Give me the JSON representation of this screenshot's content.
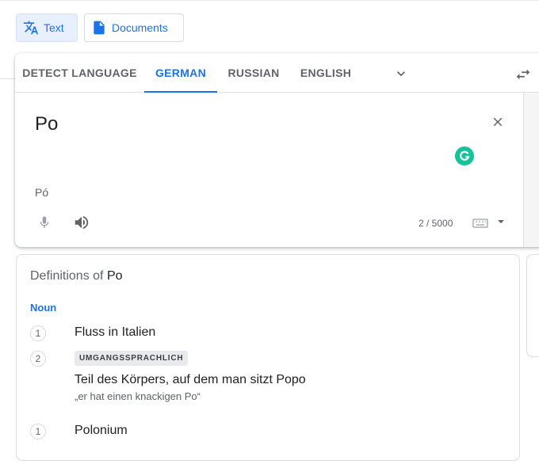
{
  "mode_tabs": [
    {
      "label": "Text",
      "icon": "translate-icon",
      "active": true
    },
    {
      "label": "Documents",
      "icon": "document-icon",
      "active": false
    }
  ],
  "languages": {
    "tabs": [
      "DETECT LANGUAGE",
      "GERMAN",
      "RUSSIAN",
      "ENGLISH"
    ],
    "selected": "GERMAN"
  },
  "input": {
    "text": "Po",
    "transliteration": "Pó",
    "char_count": "2 / 5000"
  },
  "definitions": {
    "title_prefix": "Definitions of",
    "word": "Po",
    "part_of_speech": "Noun",
    "entries": [
      {
        "num": "1",
        "gloss": "Fluss in Italien"
      },
      {
        "num": "2",
        "label": "UMGANGSSPRACHLICH",
        "gloss": "Teil des Körpers, auf dem man sitzt Popo",
        "example": "„er hat einen knackigen Po“"
      },
      {
        "num": "1",
        "gloss": "Polonium"
      }
    ]
  },
  "colors": {
    "accent": "#1a73e8",
    "grammarly": "#15c39a"
  }
}
